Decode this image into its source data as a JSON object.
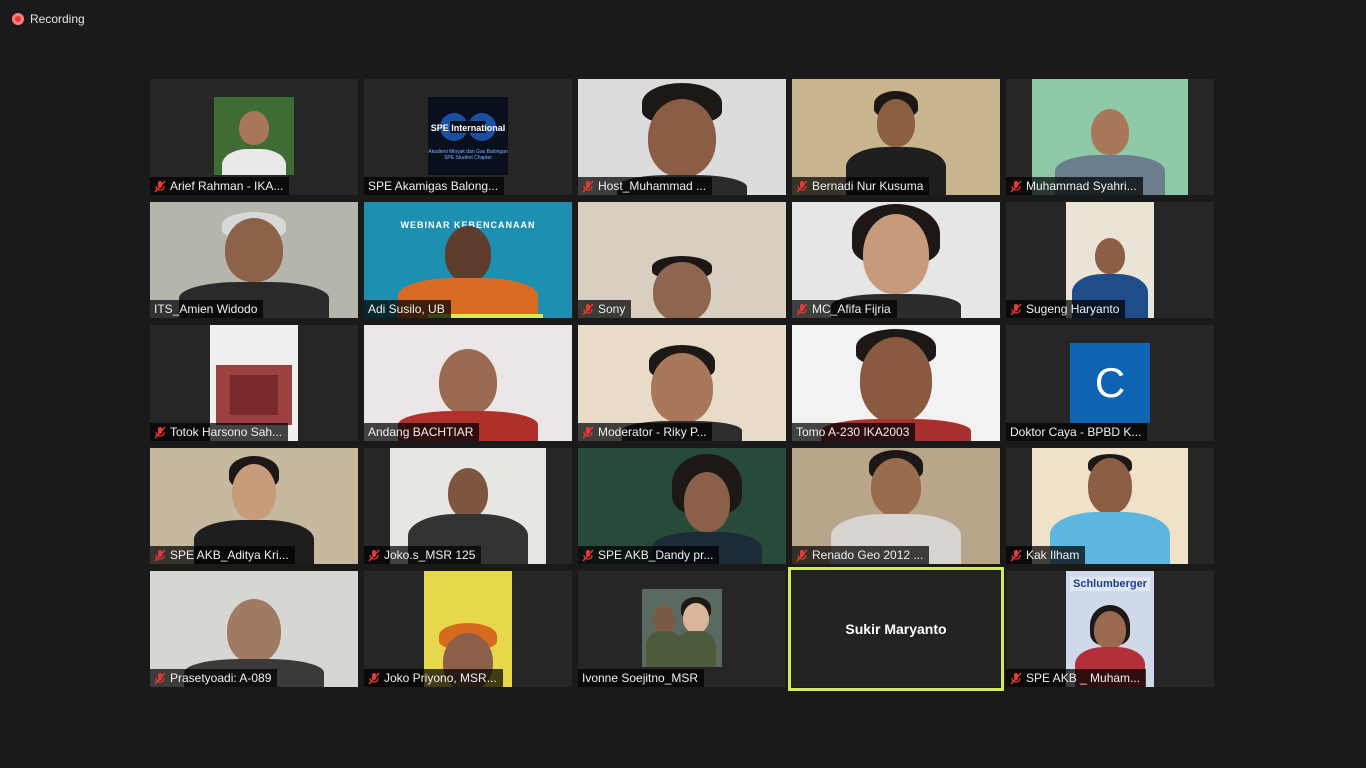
{
  "recording": {
    "label": "Recording"
  },
  "participants": [
    {
      "name": "Arief Rahman - IKA...",
      "muted": true
    },
    {
      "name": "SPE Akamigas Balong...",
      "muted": false,
      "logo_caption": "Akademi Minyak dan Gas Balongan SPE Student Chapter",
      "logo_text": "SPE International"
    },
    {
      "name": "Host_Muhammad ...",
      "muted": true
    },
    {
      "name": "Bernadi Nur Kusuma",
      "muted": true
    },
    {
      "name": "Muhammad Syahri...",
      "muted": true
    },
    {
      "name": "ITS_Amien Widodo",
      "muted": false
    },
    {
      "name": "Adi Susilo, UB",
      "muted": false,
      "banner_text": "WEBINAR KEBENCANAAN"
    },
    {
      "name": "Sony",
      "muted": true
    },
    {
      "name": "MC_Afifa Fijria",
      "muted": true
    },
    {
      "name": "Sugeng Haryanto",
      "muted": true
    },
    {
      "name": "Totok Harsono Sah...",
      "muted": true
    },
    {
      "name": "Andang BACHTIAR",
      "muted": false
    },
    {
      "name": "Moderator - Riky P...",
      "muted": true
    },
    {
      "name": "Tomo A-230 IKA2003",
      "muted": false
    },
    {
      "name": "Doktor Caya - BPBD K...",
      "muted": false,
      "avatar_letter": "C"
    },
    {
      "name": "SPE AKB_Aditya Kri...",
      "muted": true
    },
    {
      "name": "Joko.s_MSR 125",
      "muted": true
    },
    {
      "name": "SPE AKB_Dandy pr...",
      "muted": true
    },
    {
      "name": "Renado Geo 2012 ...",
      "muted": true
    },
    {
      "name": "Kak Ilham",
      "muted": true
    },
    {
      "name": "Prasetyoadi: A-089",
      "muted": true
    },
    {
      "name": "Joko Priyono, MSR...",
      "muted": true
    },
    {
      "name": "Ivonne Soejitno_MSR",
      "muted": false
    },
    {
      "name": "Sukir Maryanto",
      "muted": false,
      "camera_off": true
    },
    {
      "name": "SPE AKB _ Muham...",
      "muted": true,
      "logo_text": "Schlumberger"
    }
  ],
  "colors": {
    "background": "#1a1a1a",
    "tile": "#262626",
    "active_speaker": "#d5ea5a",
    "muted_icon": "#e53935",
    "recording_dot": "#e53935"
  }
}
